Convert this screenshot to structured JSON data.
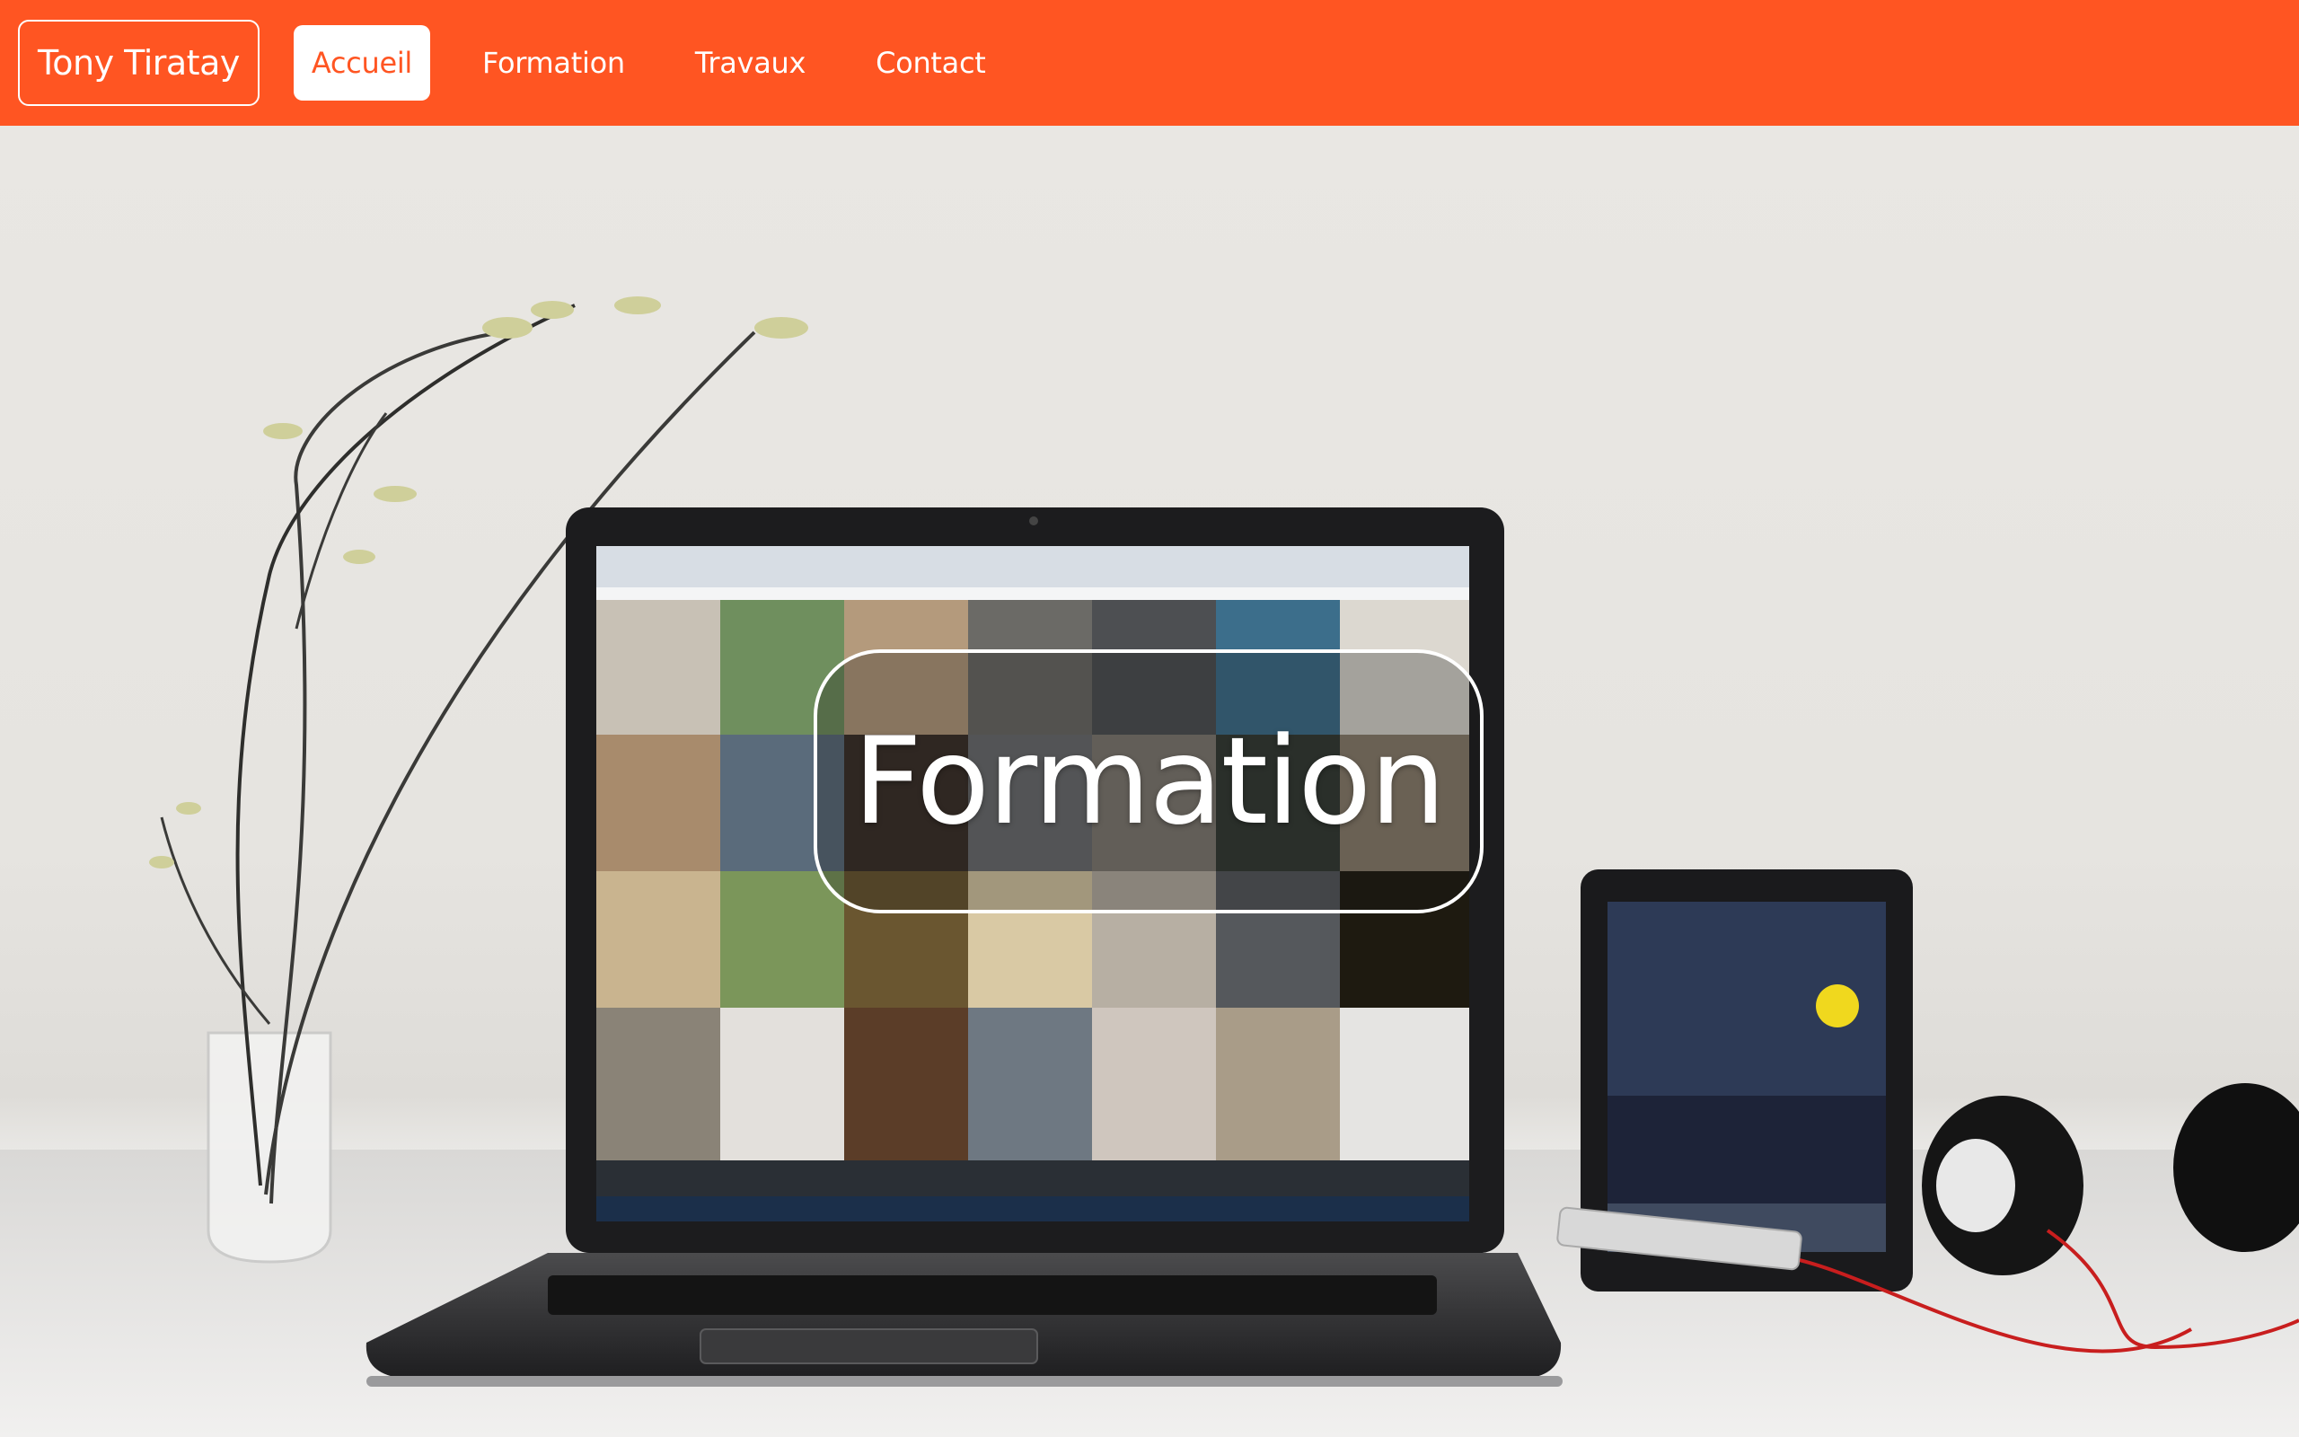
{
  "nav": {
    "brand": "Tony Tiratay",
    "links": [
      {
        "label": "Accueil",
        "active": true
      },
      {
        "label": "Formation",
        "active": false
      },
      {
        "label": "Travaux",
        "active": false
      },
      {
        "label": "Contact",
        "active": false
      }
    ]
  },
  "hero": {
    "title": "Formation"
  },
  "colors": {
    "accent": "#ff5522",
    "nav_text": "#ffffff",
    "active_background": "#ffffff"
  }
}
